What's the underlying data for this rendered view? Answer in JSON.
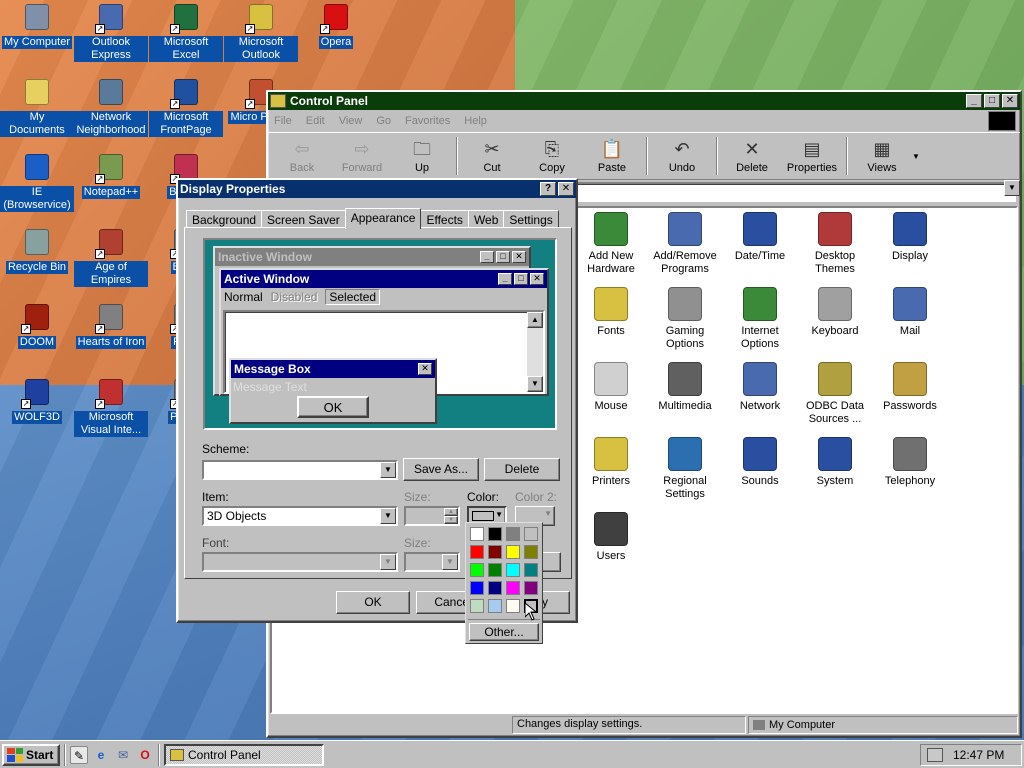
{
  "desktop": {
    "icons": [
      {
        "label": "My Computer",
        "icon": "my-computer-icon"
      },
      {
        "label": "Outlook Express",
        "icon": "outlook-express-icon"
      },
      {
        "label": "Microsoft Excel",
        "icon": "excel-icon"
      },
      {
        "label": "Microsoft Outlook",
        "icon": "outlook-icon"
      },
      {
        "label": "Opera",
        "icon": "opera-icon"
      },
      {
        "label": "My Documents",
        "icon": "folder-icon"
      },
      {
        "label": "Network Neighborhood",
        "icon": "network-icon"
      },
      {
        "label": "Microsoft FrontPage",
        "icon": "frontpage-icon"
      },
      {
        "label": "Micro Power",
        "icon": "powerpoint-icon"
      },
      {
        "label": "IE (Browservice)",
        "icon": "ie-icon"
      },
      {
        "label": "Notepad++",
        "icon": "notepad-icon"
      },
      {
        "label": "Bete D",
        "icon": "gem-icon"
      },
      {
        "label": "Recycle Bin",
        "icon": "recycle-bin-icon"
      },
      {
        "label": "Age of Empires",
        "icon": "age-of-empires-icon"
      },
      {
        "label": "Big D",
        "icon": "app-icon"
      },
      {
        "label": "DOOM",
        "icon": "doom-icon"
      },
      {
        "label": "Hearts of Iron",
        "icon": "hearts-of-iron-icon"
      },
      {
        "label": "Pagg",
        "icon": "app-icon"
      },
      {
        "label": "WOLF3D",
        "icon": "wolf3d-icon"
      },
      {
        "label": "Microsoft Visual Inte...",
        "icon": "visual-interdev-icon"
      },
      {
        "label": "Pla Ze",
        "icon": "app-icon"
      }
    ]
  },
  "control_panel": {
    "title": "Control Panel",
    "menu": [
      "File",
      "Edit",
      "View",
      "Go",
      "Favorites",
      "Help"
    ],
    "toolbar": {
      "back": "Back",
      "forward": "Forward",
      "up": "Up",
      "cut": "Cut",
      "copy": "Copy",
      "paste": "Paste",
      "undo": "Undo",
      "delete": "Delete",
      "properties": "Properties",
      "views": "Views"
    },
    "items": [
      {
        "label": "Add New Hardware",
        "color": "#3a8a3a"
      },
      {
        "label": "Add/Remove Programs",
        "color": "#4a6ab0"
      },
      {
        "label": "Date/Time",
        "color": "#2b4fa0"
      },
      {
        "label": "Desktop Themes",
        "color": "#b03a3a"
      },
      {
        "label": "Display",
        "color": "#2b4fa0"
      },
      {
        "label": "Fonts",
        "color": "#d8c040"
      },
      {
        "label": "Gaming Options",
        "color": "#909090"
      },
      {
        "label": "Internet Options",
        "color": "#3a8a3a"
      },
      {
        "label": "Keyboard",
        "color": "#a0a0a0"
      },
      {
        "label": "Mail",
        "color": "#4a6ab0"
      },
      {
        "label": "Mouse",
        "color": "#d0d0d0"
      },
      {
        "label": "Multimedia",
        "color": "#606060"
      },
      {
        "label": "Network",
        "color": "#4a6ab0"
      },
      {
        "label": "ODBC Data Sources ...",
        "color": "#b0a040"
      },
      {
        "label": "Passwords",
        "color": "#c0a040"
      },
      {
        "label": "Printers",
        "color": "#d8c040"
      },
      {
        "label": "Regional Settings",
        "color": "#2b6fb0"
      },
      {
        "label": "Sounds",
        "color": "#2b4fa0"
      },
      {
        "label": "System",
        "color": "#2b4fa0"
      },
      {
        "label": "Telephony",
        "color": "#707070"
      },
      {
        "label": "Users",
        "color": "#404040"
      }
    ],
    "status_left": "Changes display settings.",
    "status_right": "My Computer"
  },
  "display_properties": {
    "title": "Display Properties",
    "help_btn": "?",
    "close_btn": "✕",
    "tabs": [
      "Background",
      "Screen Saver",
      "Appearance",
      "Effects",
      "Web",
      "Settings"
    ],
    "preview": {
      "inactive_title": "Inactive Window",
      "active_title": "Active Window",
      "menu_normal": "Normal",
      "menu_disabled": "Disabled",
      "menu_selected": "Selected",
      "msgbox_title": "Message Box",
      "msgbox_text": "Message Text",
      "msgbox_ok": "OK"
    },
    "scheme_label": "Scheme:",
    "scheme_value": "",
    "save_as": "Save As...",
    "delete": "Delete",
    "item_label": "Item:",
    "item_value": "3D Objects",
    "size_label": "Size:",
    "color_label": "Color:",
    "color2_label": "Color 2:",
    "font_label": "Font:",
    "font_size_label": "Size:",
    "ok": "OK",
    "cancel": "Cancel",
    "apply": "Apply",
    "palette_other": "Other...",
    "palette_colors": [
      "#ffffff",
      "#000000",
      "#808080",
      "#c0c0c0",
      "#ff0000",
      "#800000",
      "#ffff00",
      "#808000",
      "#00ff00",
      "#008000",
      "#00ffff",
      "#008080",
      "#0000ff",
      "#000080",
      "#ff00ff",
      "#800080",
      "#c0dcc0",
      "#a6caf0",
      "#fffbf0",
      "#c0c0c0"
    ]
  },
  "taskbar": {
    "start": "Start",
    "task": "Control Panel",
    "time": "12:47 PM"
  }
}
